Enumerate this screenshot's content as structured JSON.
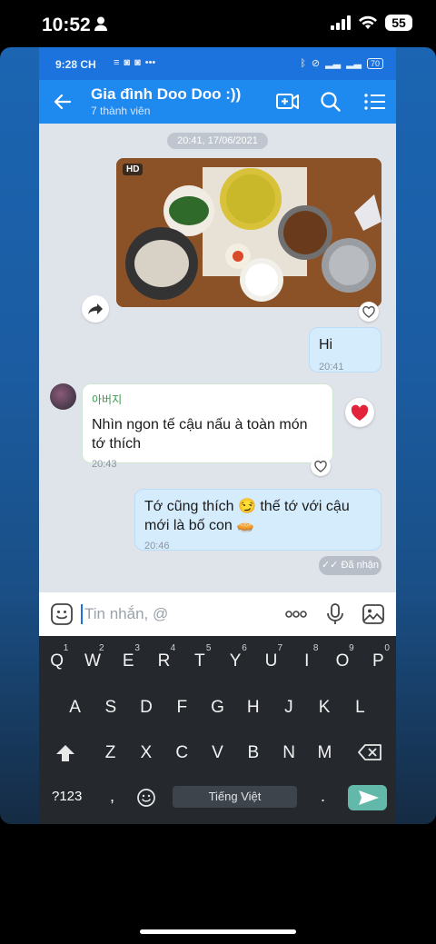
{
  "ios_status": {
    "time": "10:52",
    "battery": "55"
  },
  "android_status": {
    "time": "9:28 CH",
    "battery": "70"
  },
  "header": {
    "title": "Gia đình Doo Doo :))",
    "subtitle": "7 thành viên"
  },
  "chat": {
    "date_separator": "20:41, 17/06/2021",
    "photo_badge": "HD",
    "messages": [
      {
        "from": "me",
        "text": "Hi",
        "time": "20:41"
      },
      {
        "from": "other",
        "sender": "아버지",
        "text": "Nhìn ngon tế cậu nấu à toàn món tớ thích",
        "time": "20:43"
      },
      {
        "from": "me",
        "text": "Tớ cũng thích 😏 thế tớ với cậu mới là bố con 🥧",
        "time": "20:46"
      }
    ],
    "delivery_status": "Đã nhận"
  },
  "input": {
    "placeholder": "Tin nhắn, @"
  },
  "keyboard": {
    "row1": [
      "Q",
      "W",
      "E",
      "R",
      "T",
      "Y",
      "U",
      "I",
      "O",
      "P"
    ],
    "row1_hints": [
      "1",
      "2",
      "3",
      "4",
      "5",
      "6",
      "7",
      "8",
      "9",
      "0"
    ],
    "row2": [
      "A",
      "S",
      "D",
      "F",
      "G",
      "H",
      "J",
      "K",
      "L"
    ],
    "row3": [
      "Z",
      "X",
      "C",
      "V",
      "B",
      "N",
      "M"
    ],
    "numbers_key": "?123",
    "comma_key": ",",
    "period_key": ".",
    "space_label": "Tiếng Việt"
  },
  "colors": {
    "header": "#1e8af0",
    "my_bubble": "#d5ecfd",
    "send": "#63b9a9"
  },
  "icons": [
    "person-icon",
    "signal-icon",
    "wifi-icon",
    "back-arrow-icon",
    "video-call-icon",
    "search-icon",
    "menu-icon",
    "share-icon",
    "heart-icon",
    "emoji-icon",
    "more-icon",
    "mic-icon",
    "gallery-icon",
    "shift-icon",
    "backspace-icon",
    "send-icon"
  ]
}
